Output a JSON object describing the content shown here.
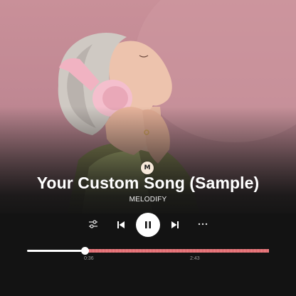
{
  "player": {
    "badge_letter": "M",
    "song_title": "Your Custom Song (Sample)",
    "artist": "MELODIFY",
    "state": "playing",
    "current_time": "0:36",
    "total_time": "2:43",
    "progress_fraction": 0.2372
  },
  "icons": {
    "eq": "sliders-icon",
    "prev": "skip-previous-icon",
    "play": "pause-icon",
    "next": "skip-next-icon",
    "more": "more-horizontal-icon"
  },
  "colors": {
    "hero_pink": "#c99099",
    "background": "#131313",
    "progress_played": "#ffffff",
    "progress_remaining": "#e06b71"
  }
}
